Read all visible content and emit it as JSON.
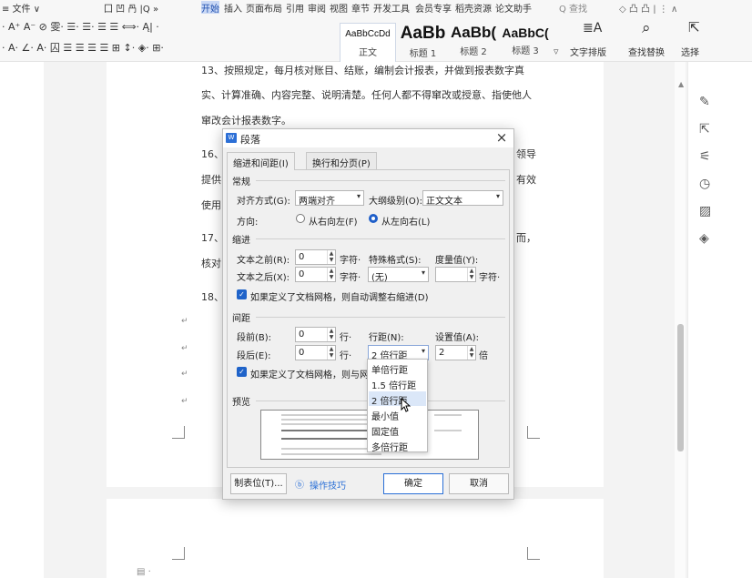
{
  "menubar": {
    "items": [
      "≡ 文件 ∨",
      "囗 凹 冎 |Q »",
      "开始",
      "插入",
      "页面布局",
      "引用",
      "审阅",
      "视图",
      "章节",
      "开发工具",
      "会员专享",
      "稻壳资源",
      "论文助手"
    ],
    "search": "Q 查找",
    "right_icons": "◇ 凸 凸 | ⋮ ∧"
  },
  "ribbon": {
    "row1": "· A⁺ A⁻ ⊘ 雯·  ☰· ☰· ☰ ☰ ⟺· Ą| ·",
    "row2": "· A· ∠· A· 囚   ☰ ☰ ☰ ☰ ⊞ ↕· ◈· ⊞·",
    "styles": [
      {
        "preview": "AaBbCcDd",
        "caption": "正文"
      },
      {
        "preview": "AaBb",
        "caption": "标题 1"
      },
      {
        "preview": "AaBb(",
        "caption": "标题 2"
      },
      {
        "preview": "AaBbC(",
        "caption": "标题 3"
      }
    ],
    "text_layout": "文字排版",
    "find_replace": "查找替换",
    "select": "选择"
  },
  "document": {
    "lines": [
      "13、按照规定，每月核对账目、结账，编制会计报表，并做到报表数字真",
      "实、计算准确、内容完整、说明清楚。任何人都不得窜改或授意、指使他人",
      "窜改会计报表数字。",
      "16、",
      "提供",
      "使用",
      "17、",
      "核对",
      "18、"
    ],
    "right_fragments": [
      "领导",
      "有效",
      "而，"
    ]
  },
  "dialog": {
    "title": "段落",
    "tabs": [
      "缩进和间距(I)",
      "换行和分页(P)"
    ],
    "general": {
      "section": "常规",
      "alignment_label": "对齐方式(G):",
      "alignment_value": "两端对齐",
      "outline_label": "大纲级别(O):",
      "outline_value": "正文文本",
      "direction_label": "方向:",
      "rtl": "从右向左(F)",
      "ltr": "从左向右(L)"
    },
    "indent": {
      "section": "缩进",
      "before_label": "文本之前(R):",
      "before_value": "0",
      "before_unit": "字符·",
      "special_label": "特殊格式(S):",
      "special_value": "(无)",
      "measure_label": "度量值(Y):",
      "measure_value": "",
      "measure_unit": "字符·",
      "after_label": "文本之后(X):",
      "after_value": "0",
      "after_unit": "字符·",
      "auto_adjust": "如果定义了文档网格，则自动调整右缩进(D)"
    },
    "spacing": {
      "section": "间距",
      "before_label": "段前(B):",
      "before_value": "0",
      "before_unit": "行·",
      "line_label": "行距(N):",
      "line_value": "2 倍行距",
      "setting_label": "设置值(A):",
      "setting_value": "2",
      "setting_unit": "倍",
      "after_label": "段后(E):",
      "after_value": "0",
      "after_unit": "行·",
      "snap_grid": "如果定义了文档网格，则与网"
    },
    "preview_label": "预览",
    "line_spacing_options": [
      "单倍行距",
      "1.5 倍行距",
      "2 倍行距",
      "最小值",
      "固定值",
      "多倍行距"
    ],
    "selected_option": "2 倍行距",
    "buttons": {
      "tabs": "制表位(T)...",
      "tips": "操作技巧",
      "ok": "确定",
      "cancel": "取消"
    }
  },
  "colors": {
    "accent": "#1f63c9",
    "ok_border": "#2a6fd6"
  }
}
